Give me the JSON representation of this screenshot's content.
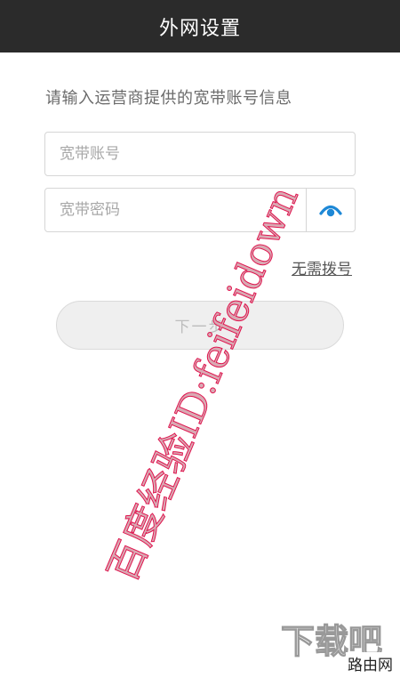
{
  "header": {
    "title": "外网设置"
  },
  "form": {
    "hint": "请输入运营商提供的宽带账号信息",
    "account_placeholder": "宽带账号",
    "password_placeholder": "宽带密码",
    "show_password_icon": "eye-icon",
    "no_dial_label": "无需拨号",
    "next_label": "下一步"
  },
  "watermark": {
    "text": "百度经验ID:feifeidown"
  },
  "brand": {
    "logo_text": "下载吧",
    "site_text": "路由网"
  },
  "colors": {
    "header_bg": "#2b2b2b",
    "accent": "#1e88d6",
    "watermark": "#e0154f"
  }
}
